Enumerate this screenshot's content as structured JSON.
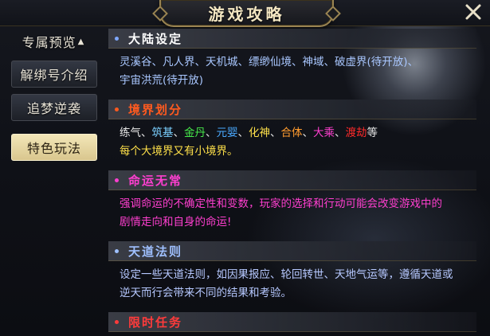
{
  "header": {
    "title": "游戏攻略",
    "close_icon": "close-x-icon"
  },
  "sidebar": {
    "items": [
      {
        "label": "专属预览",
        "arrow": "▲",
        "active": false
      },
      {
        "label": "解绑号介绍",
        "active": false
      },
      {
        "label": "追梦逆袭",
        "active": false
      },
      {
        "label": "特色玩法",
        "active": true
      }
    ]
  },
  "sections": [
    {
      "title": "大陆设定",
      "title_color": "#ffffff",
      "bullet_color": "#7fa8ff",
      "lines": [
        "灵溪谷、凡人界、天机城、缥缈仙境、神域、破虚界(待开放)、",
        "宇宙洪荒(待开放)"
      ],
      "line_color": "#a9c7ff"
    },
    {
      "title": "境界划分",
      "title_color": "#ff5a1f",
      "bullet_color": "#ff5a1f",
      "realms": [
        {
          "text": "练气、",
          "color": "#e6e6e6"
        },
        {
          "text": "筑基",
          "color": "#7bd0ff"
        },
        {
          "text": "、",
          "color": "#e6e6e6"
        },
        {
          "text": "金丹",
          "color": "#46e84a"
        },
        {
          "text": "、",
          "color": "#e6e6e6"
        },
        {
          "text": "元婴",
          "color": "#4aa9ff"
        },
        {
          "text": "、",
          "color": "#e6e6e6"
        },
        {
          "text": "化神",
          "color": "#ffe14a"
        },
        {
          "text": "、",
          "color": "#e6e6e6"
        },
        {
          "text": "合体",
          "color": "#ff9b2e"
        },
        {
          "text": "、",
          "color": "#e6e6e6"
        },
        {
          "text": "大乘",
          "color": "#ff3fd0"
        },
        {
          "text": "、",
          "color": "#e6e6e6"
        },
        {
          "text": "渡劫",
          "color": "#ff2a2a"
        },
        {
          "text": "等",
          "color": "#e6e6e6"
        }
      ],
      "note": "每个大境界又有小境界。",
      "note_color": "#ffe14a"
    },
    {
      "title": "命运无常",
      "title_color": "#ff3fd0",
      "bullet_color": "#ff3fd0",
      "lines": [
        "强调命运的不确定性和变数，玩家的选择和行动可能会改变游戏中的",
        "剧情走向和自身的命运!"
      ],
      "line_color": "#ff3fd0"
    },
    {
      "title": "天道法则",
      "title_color": "#9fc0ff",
      "bullet_color": "#9fc0ff",
      "lines": [
        "设定一些天道法则，如因果报应、轮回转世、天地气运等，遵循天道或",
        "逆天而行会带来不同的结果和考验。"
      ],
      "line_color": "#b6c8ff"
    },
    {
      "title": "限时任务",
      "title_color": "#ff3b3b",
      "bullet_color": "#ff3b3b",
      "lines": [],
      "line_color": "#ff3b3b"
    }
  ]
}
